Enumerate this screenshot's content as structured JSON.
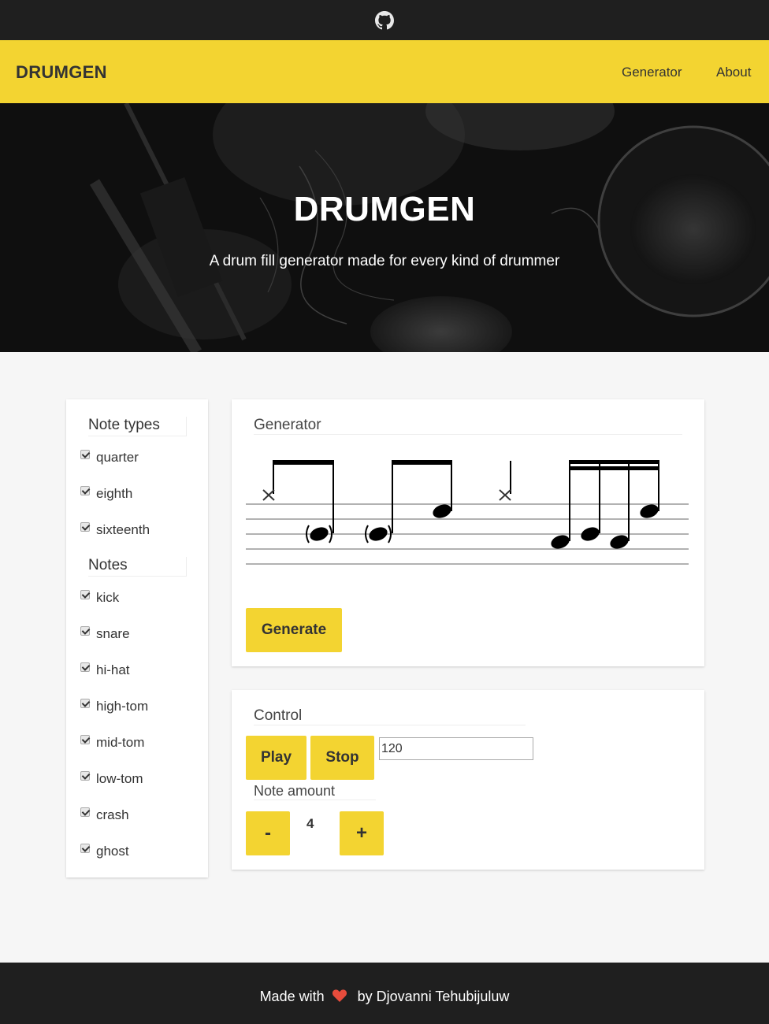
{
  "colors": {
    "accent": "#f3d431",
    "dark": "#1f1f1f",
    "page_bg": "#f6f6f6",
    "heart": "#e74c3c"
  },
  "topbar": {
    "icon": "github-icon"
  },
  "navbar": {
    "brand": "DRUMGEN",
    "links": [
      "Generator",
      "About"
    ]
  },
  "hero": {
    "title": "DRUMGEN",
    "subtitle": "A drum fill generator made for every kind of drummer"
  },
  "sidebar": {
    "note_types_label": "Note types",
    "note_types": [
      {
        "label": "quarter",
        "checked": true
      },
      {
        "label": "eighth",
        "checked": true
      },
      {
        "label": "sixteenth",
        "checked": true
      }
    ],
    "notes_label": "Notes",
    "notes": [
      {
        "label": "kick",
        "checked": true
      },
      {
        "label": "snare",
        "checked": true
      },
      {
        "label": "hi-hat",
        "checked": true
      },
      {
        "label": "high-tom",
        "checked": true
      },
      {
        "label": "mid-tom",
        "checked": true
      },
      {
        "label": "low-tom",
        "checked": true
      },
      {
        "label": "crash",
        "checked": true
      },
      {
        "label": "ghost",
        "checked": true
      }
    ]
  },
  "generator": {
    "title": "Generator",
    "generate_label": "Generate"
  },
  "control": {
    "title": "Control",
    "play_label": "Play",
    "stop_label": "Stop",
    "tempo_value": "120",
    "note_amount_label": "Note amount",
    "decrement_label": "-",
    "increment_label": "+",
    "note_amount_value": "4"
  },
  "footer": {
    "made_with": "Made with",
    "by_author": "by Djovanni Tehubijuluw",
    "icon": "heart-icon"
  }
}
